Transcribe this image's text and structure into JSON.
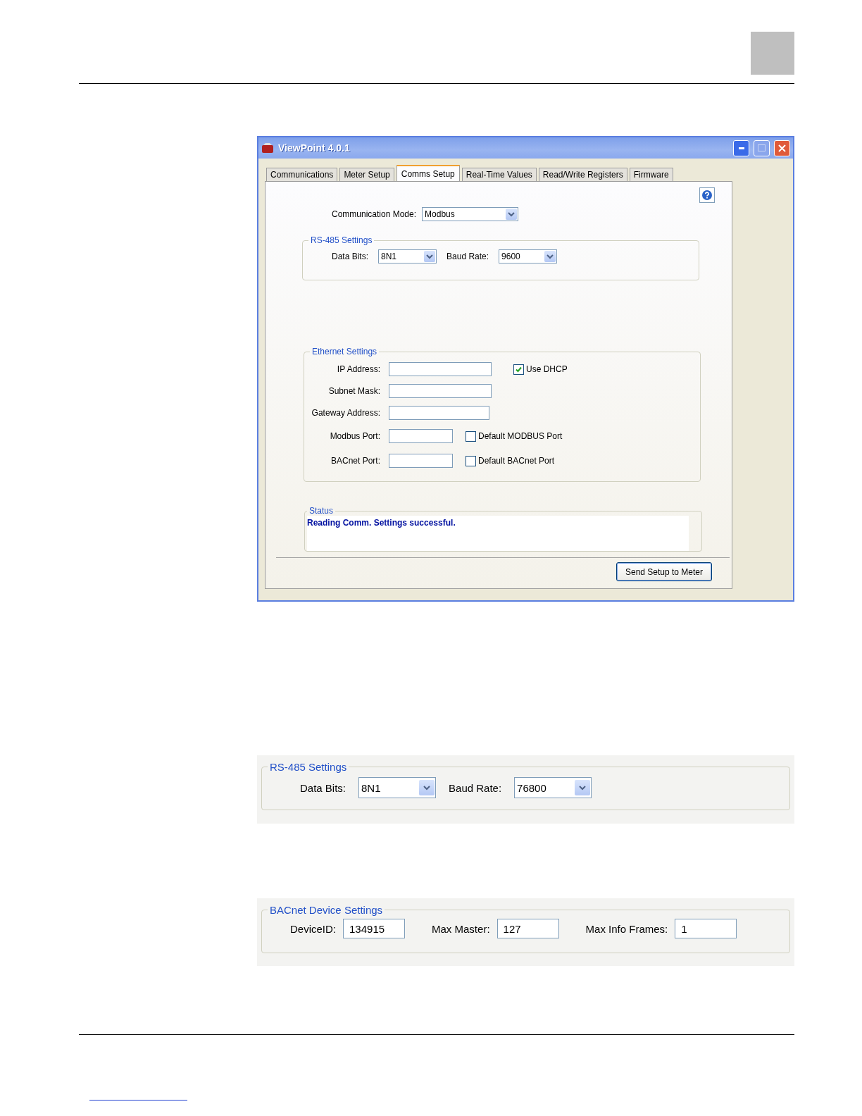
{
  "window": {
    "title": "ViewPoint 4.0.1",
    "tabs": [
      {
        "label": "Communications",
        "selected": false
      },
      {
        "label": "Meter Setup",
        "selected": false
      },
      {
        "label": "Comms Setup",
        "selected": true
      },
      {
        "label": "Real-Time Values",
        "selected": false
      },
      {
        "label": "Read/Write Registers",
        "selected": false
      },
      {
        "label": "Firmware",
        "selected": false
      }
    ],
    "communication_mode": {
      "label": "Communication Mode:",
      "value": "Modbus"
    },
    "rs485_settings": {
      "title": "RS-485 Settings",
      "fields": [
        {
          "label": "Data Bits:",
          "value": "8N1"
        },
        {
          "label": "Baud Rate:",
          "value": "9600"
        }
      ]
    },
    "ethernet_settings": {
      "title": "Ethernet Settings",
      "rows": [
        {
          "label": "IP Address:",
          "checkbox": {
            "label": "Use DHCP",
            "checked": true
          }
        },
        {
          "label": "Subnet Mask:"
        },
        {
          "label": "Gateway Address:"
        },
        {
          "label": "Modbus Port:",
          "checkbox": {
            "label": "Default MODBUS Port",
            "checked": false
          }
        },
        {
          "label": "BACnet Port:",
          "checkbox": {
            "label": "Default BACnet Port",
            "checked": false
          }
        }
      ]
    },
    "status": {
      "title": "Status",
      "message": "Reading Comm. Settings successful."
    },
    "button": "Send Setup to Meter"
  },
  "rs485_detail": {
    "title": "RS-485 Settings",
    "fields": [
      {
        "label": "Data Bits:",
        "value": "8N1"
      },
      {
        "label": "Baud Rate:",
        "value": "76800"
      }
    ]
  },
  "bacnet_device_settings": {
    "title": "BACnet Device Settings",
    "fields": [
      {
        "label": "DeviceID:",
        "value": "134915"
      },
      {
        "label": "Max Master:",
        "value": "127"
      },
      {
        "label": "Max Info Frames:",
        "value": "1"
      }
    ]
  }
}
